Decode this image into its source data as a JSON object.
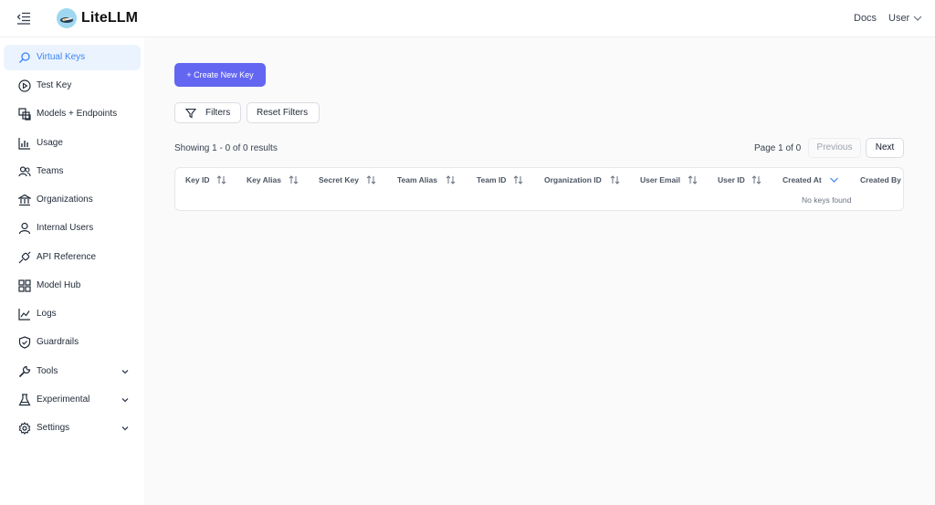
{
  "header": {
    "brand": "LiteLLM",
    "docs_label": "Docs",
    "user_label": "User"
  },
  "sidebar": {
    "items": [
      {
        "label": "Virtual Keys",
        "icon": "key-search-icon",
        "active": true
      },
      {
        "label": "Test Key",
        "icon": "play-circle-icon"
      },
      {
        "label": "Models + Endpoints",
        "icon": "blocks-icon"
      },
      {
        "label": "Usage",
        "icon": "bar-chart-icon"
      },
      {
        "label": "Teams",
        "icon": "team-icon"
      },
      {
        "label": "Organizations",
        "icon": "bank-icon"
      },
      {
        "label": "Internal Users",
        "icon": "user-icon"
      },
      {
        "label": "API Reference",
        "icon": "api-icon"
      },
      {
        "label": "Model Hub",
        "icon": "grid-icon"
      },
      {
        "label": "Logs",
        "icon": "line-chart-icon"
      },
      {
        "label": "Guardrails",
        "icon": "shield-icon"
      },
      {
        "label": "Tools",
        "icon": "tool-icon",
        "expandable": true
      },
      {
        "label": "Experimental",
        "icon": "flask-icon",
        "expandable": true
      },
      {
        "label": "Settings",
        "icon": "gear-icon",
        "expandable": true
      }
    ]
  },
  "main": {
    "create_button": "+ Create New Key",
    "filters_button": "Filters",
    "reset_filters_button": "Reset Filters",
    "showing_text": "Showing 1 - 0 of 0 results",
    "page_info": "Page 1 of 0",
    "previous_label": "Previous",
    "next_label": "Next",
    "table": {
      "columns": [
        "Key ID",
        "Key Alias",
        "Secret Key",
        "Team Alias",
        "Team ID",
        "Organization ID",
        "User Email",
        "User ID",
        "Created At",
        "Created By"
      ],
      "sorted_column": "Created At",
      "empty_text": "No keys found"
    }
  },
  "colors": {
    "accent": "#6366f1",
    "active_nav_bg": "#ebf4fe",
    "active_nav_text": "#3b82f6"
  }
}
